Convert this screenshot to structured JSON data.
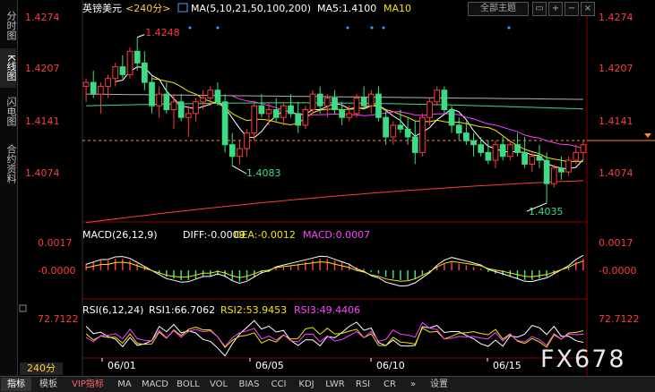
{
  "sidebar": {
    "tabs": [
      {
        "label": "分时图",
        "active": false
      },
      {
        "label": "K线图",
        "active": true
      },
      {
        "label": "闪电图",
        "active": false
      },
      {
        "label": "合约资料",
        "active": false
      }
    ]
  },
  "header": {
    "symbol": "英镑美元",
    "period": "<240分>",
    "ma_label": "MA(5,10,21,50,100,200)",
    "ma5_text": "MA5:1.4100",
    "ma10_text": "MA10"
  },
  "top_controls": {
    "theme": "全部主题"
  },
  "price_axis": {
    "ticks": [
      "1.4274",
      "1.4207",
      "1.4141",
      "1.4074"
    ],
    "current": "1.4141"
  },
  "annotations": {
    "high": "1.4248",
    "low1": "1.4083",
    "low2": "1.4035"
  },
  "macd": {
    "label": "MACD(26,12,9)",
    "diff": "DIFF:-0.0009",
    "dea": "DEA:-0.0012",
    "macd": "MACD:0.0007",
    "ticks": [
      "0.0017",
      "-0.0000"
    ]
  },
  "rsi": {
    "label": "RSI(6,12,24)",
    "rsi1": "RSI1:66.7062",
    "rsi2": "RSI2:53.9453",
    "rsi3": "RSI3:49.4406",
    "tick": "72.7122"
  },
  "date_axis": {
    "labels": [
      "06/01",
      "06/05",
      "06/10",
      "06/15"
    ]
  },
  "period_tab": "240分",
  "watermark": "FX678",
  "bottom_tabs": [
    {
      "label": "指标",
      "active": true,
      "vip": false
    },
    {
      "label": "模板",
      "active": false,
      "vip": false
    },
    {
      "label": "VIP指标",
      "active": false,
      "vip": true
    },
    {
      "label": "MA",
      "active": false,
      "vip": false
    },
    {
      "label": "MACD",
      "active": false,
      "vip": false
    },
    {
      "label": "BOLL",
      "active": false,
      "vip": false
    },
    {
      "label": "VOL",
      "active": false,
      "vip": false
    },
    {
      "label": "BIAS",
      "active": false,
      "vip": false
    },
    {
      "label": "CCI",
      "active": false,
      "vip": false
    },
    {
      "label": "KDJ",
      "active": false,
      "vip": false
    },
    {
      "label": "LWR",
      "active": false,
      "vip": false
    },
    {
      "label": "RSI",
      "active": false,
      "vip": false
    },
    {
      "label": "CR",
      "active": false,
      "vip": false
    },
    {
      "label": "»",
      "active": false,
      "vip": false
    },
    {
      "label": "设置",
      "active": false,
      "vip": false
    }
  ],
  "colors": {
    "up": "#ff3b3b",
    "down": "#3ddc84",
    "ma5": "#ffffff",
    "ma10": "#f2e600",
    "ma21": "#ff40ff",
    "ma50": "#3ddc84",
    "ma100": "#b0b0b0",
    "ma200": "#ff3b3b",
    "axis": "#ff3b3b"
  },
  "chart_data": {
    "type": "candlestick",
    "ylim": [
      1.4035,
      1.4274
    ],
    "candles": [
      [
        1.4185,
        1.4195,
        1.4165,
        1.419
      ],
      [
        1.419,
        1.4205,
        1.417,
        1.4175
      ],
      [
        1.4175,
        1.419,
        1.415,
        1.4185
      ],
      [
        1.4185,
        1.42,
        1.417,
        1.4195
      ],
      [
        1.4195,
        1.4215,
        1.4185,
        1.421
      ],
      [
        1.421,
        1.4225,
        1.4195,
        1.42
      ],
      [
        1.42,
        1.4235,
        1.4195,
        1.423
      ],
      [
        1.423,
        1.4248,
        1.4205,
        1.4215
      ],
      [
        1.4215,
        1.423,
        1.418,
        1.419
      ],
      [
        1.419,
        1.42,
        1.415,
        1.416
      ],
      [
        1.416,
        1.4185,
        1.4145,
        1.4175
      ],
      [
        1.4175,
        1.419,
        1.415,
        1.4155
      ],
      [
        1.4155,
        1.4175,
        1.413,
        1.4165
      ],
      [
        1.4165,
        1.4175,
        1.414,
        1.4145
      ],
      [
        1.4145,
        1.416,
        1.412,
        1.415
      ],
      [
        1.415,
        1.417,
        1.414,
        1.4165
      ],
      [
        1.4165,
        1.418,
        1.4155,
        1.417
      ],
      [
        1.417,
        1.4185,
        1.416,
        1.418
      ],
      [
        1.418,
        1.419,
        1.416,
        1.4165
      ],
      [
        1.4165,
        1.4175,
        1.41,
        1.411
      ],
      [
        1.411,
        1.4125,
        1.4083,
        1.4095
      ],
      [
        1.4095,
        1.4115,
        1.4085,
        1.4105
      ],
      [
        1.4105,
        1.413,
        1.4095,
        1.4125
      ],
      [
        1.4125,
        1.4165,
        1.4115,
        1.416
      ],
      [
        1.416,
        1.4175,
        1.4145,
        1.415
      ],
      [
        1.415,
        1.4165,
        1.4135,
        1.4155
      ],
      [
        1.4155,
        1.417,
        1.414,
        1.4145
      ],
      [
        1.4145,
        1.4165,
        1.4135,
        1.416
      ],
      [
        1.416,
        1.4175,
        1.4145,
        1.415
      ],
      [
        1.415,
        1.4165,
        1.4125,
        1.4135
      ],
      [
        1.4135,
        1.416,
        1.413,
        1.4155
      ],
      [
        1.4155,
        1.418,
        1.415,
        1.4175
      ],
      [
        1.4175,
        1.4185,
        1.415,
        1.416
      ],
      [
        1.416,
        1.4175,
        1.4145,
        1.417
      ],
      [
        1.417,
        1.418,
        1.415,
        1.4155
      ],
      [
        1.4155,
        1.4165,
        1.4135,
        1.4145
      ],
      [
        1.4145,
        1.416,
        1.414,
        1.415
      ],
      [
        1.415,
        1.4175,
        1.4145,
        1.417
      ],
      [
        1.417,
        1.4185,
        1.4155,
        1.416
      ],
      [
        1.416,
        1.418,
        1.415,
        1.4175
      ],
      [
        1.4175,
        1.4185,
        1.414,
        1.4145
      ],
      [
        1.4145,
        1.4155,
        1.411,
        1.412
      ],
      [
        1.412,
        1.414,
        1.411,
        1.4135
      ],
      [
        1.4135,
        1.4155,
        1.4125,
        1.413
      ],
      [
        1.413,
        1.4145,
        1.411,
        1.412
      ],
      [
        1.412,
        1.414,
        1.4085,
        1.41
      ],
      [
        1.41,
        1.415,
        1.4095,
        1.4145
      ],
      [
        1.4145,
        1.417,
        1.4135,
        1.4165
      ],
      [
        1.4165,
        1.4185,
        1.416,
        1.418
      ],
      [
        1.418,
        1.4185,
        1.415,
        1.4155
      ],
      [
        1.4155,
        1.416,
        1.4125,
        1.4135
      ],
      [
        1.4135,
        1.4145,
        1.4115,
        1.4125
      ],
      [
        1.4125,
        1.414,
        1.411,
        1.4115
      ],
      [
        1.4115,
        1.4125,
        1.4095,
        1.411
      ],
      [
        1.411,
        1.412,
        1.4095,
        1.41
      ],
      [
        1.41,
        1.4115,
        1.4085,
        1.409
      ],
      [
        1.409,
        1.4115,
        1.408,
        1.411
      ],
      [
        1.411,
        1.412,
        1.409,
        1.4095
      ],
      [
        1.4095,
        1.4115,
        1.409,
        1.411
      ],
      [
        1.411,
        1.4125,
        1.4095,
        1.41
      ],
      [
        1.41,
        1.412,
        1.408,
        1.4085
      ],
      [
        1.4085,
        1.41,
        1.4075,
        1.4095
      ],
      [
        1.4095,
        1.411,
        1.408,
        1.409
      ],
      [
        1.409,
        1.41,
        1.4035,
        1.406
      ],
      [
        1.406,
        1.4085,
        1.4055,
        1.408
      ],
      [
        1.408,
        1.4095,
        1.4065,
        1.4075
      ],
      [
        1.4075,
        1.4095,
        1.407,
        1.409
      ],
      [
        1.409,
        1.411,
        1.4085,
        1.41
      ],
      [
        1.41,
        1.4115,
        1.409,
        1.411
      ]
    ],
    "macd_hist": [
      0.0004,
      0.0005,
      0.0006,
      0.0006,
      0.0007,
      0.0007,
      0.0006,
      0.0004,
      0.0002,
      0.0,
      -0.0002,
      -0.0004,
      -0.0005,
      -0.0006,
      -0.0006,
      -0.0005,
      -0.0004,
      -0.0004,
      -0.0003,
      -0.0004,
      -0.0006,
      -0.0007,
      -0.0006,
      -0.0004,
      -0.0002,
      -0.0001,
      0.0001,
      0.0002,
      0.0003,
      0.0004,
      0.0005,
      0.0006,
      0.0007,
      0.0007,
      0.0006,
      0.0005,
      0.0004,
      0.0002,
      0.0001,
      -0.0001,
      -0.0002,
      -0.0004,
      -0.0005,
      -0.0006,
      -0.0006,
      -0.0005,
      -0.0003,
      -0.0001,
      0.0002,
      0.0004,
      0.0005,
      0.0004,
      0.0003,
      0.0002,
      0.0001,
      -0.0001,
      -0.0002,
      -0.0003,
      -0.0004,
      -0.0005,
      -0.0006,
      -0.0006,
      -0.0005,
      -0.0004,
      -0.0002,
      0.0,
      0.0002,
      0.0005,
      0.0007
    ]
  }
}
